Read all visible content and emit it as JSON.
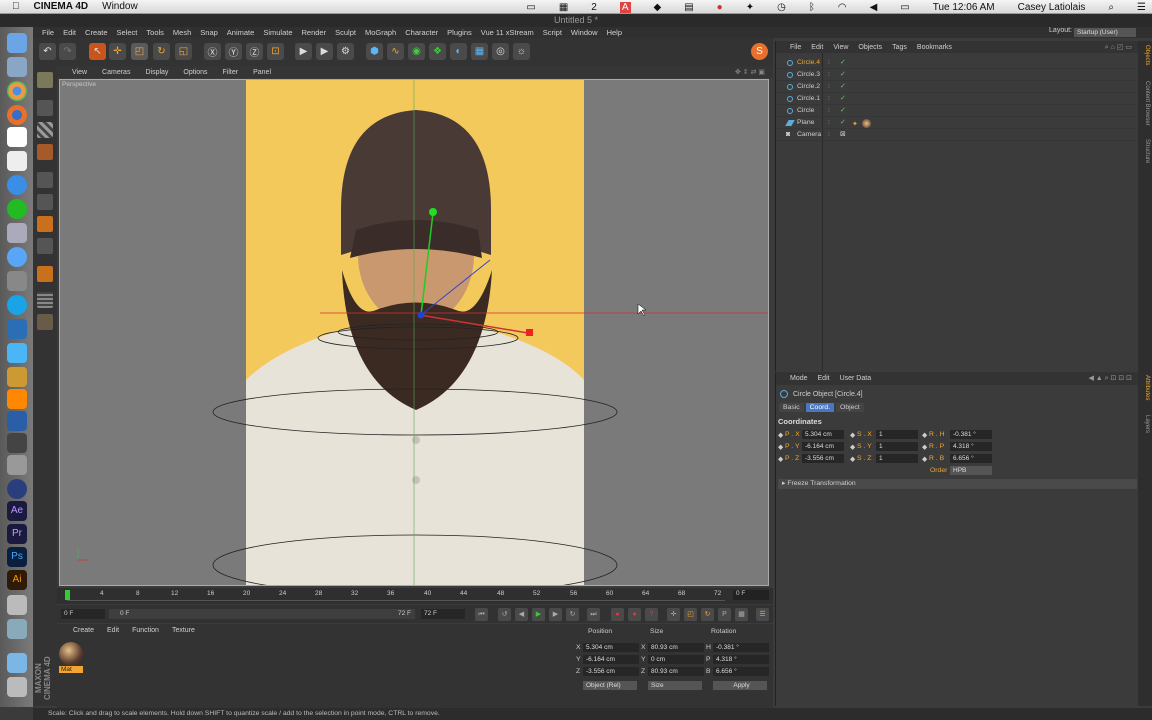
{
  "mac_menubar": {
    "app_name": "CINEMA 4D",
    "window_menu": "Window",
    "badge_count": "2",
    "time": "Tue 12:06 AM",
    "user": "Casey Latiolais"
  },
  "window_title": "Untitled 5 *",
  "menu": [
    "File",
    "Edit",
    "Create",
    "Select",
    "Tools",
    "Mesh",
    "Snap",
    "Animate",
    "Simulate",
    "Render",
    "Sculpt",
    "MoGraph",
    "Character",
    "Plugins",
    "Vue 11 xStream",
    "Script",
    "Window",
    "Help"
  ],
  "layout": {
    "label": "Layout:",
    "value": "Startup (User)"
  },
  "viewport_menu": [
    "View",
    "Cameras",
    "Display",
    "Options",
    "Filter",
    "Panel"
  ],
  "viewport_label": "Perspective",
  "timeline": {
    "ticks": [
      "0",
      "4",
      "8",
      "12",
      "16",
      "20",
      "24",
      "28",
      "32",
      "36",
      "40",
      "44",
      "48",
      "52",
      "56",
      "60",
      "64",
      "68",
      "72"
    ],
    "current_frame": "0 F"
  },
  "transport": {
    "start": "0 F",
    "preview_start": "0 F",
    "preview_end": "72 F",
    "end": "72 F"
  },
  "material_manager": {
    "menu": [
      "Create",
      "Edit",
      "Function",
      "Texture"
    ],
    "material_name": "Mat"
  },
  "maxon_logo": "MAXON CINEMA 4D",
  "coordinates": {
    "headers": [
      "Position",
      "Size",
      "Rotation"
    ],
    "rows": [
      {
        "axis": "X",
        "pos": "5.304 cm",
        "size_axis": "X",
        "size": "80.93 cm",
        "rot_axis": "H",
        "rot": "-0.381 °"
      },
      {
        "axis": "Y",
        "pos": "-6.164 cm",
        "size_axis": "Y",
        "size": "0 cm",
        "rot_axis": "P",
        "rot": "4.318 °"
      },
      {
        "axis": "Z",
        "pos": "-3.556 cm",
        "size_axis": "Z",
        "size": "80.93 cm",
        "rot_axis": "B",
        "rot": "6.656 °"
      }
    ],
    "mode_select": "Object (Rel)",
    "size_select": "Size",
    "apply_label": "Apply"
  },
  "object_manager": {
    "menu": [
      "File",
      "Edit",
      "View",
      "Objects",
      "Tags",
      "Bookmarks"
    ],
    "objects": [
      {
        "name": "Circle.4",
        "selected": true
      },
      {
        "name": "Circle.3",
        "selected": false
      },
      {
        "name": "Circle.2",
        "selected": false
      },
      {
        "name": "Circle.1",
        "selected": false
      },
      {
        "name": "Circle",
        "selected": false
      },
      {
        "name": "Plane",
        "selected": false
      },
      {
        "name": "Camera",
        "selected": false
      }
    ]
  },
  "attribute_manager": {
    "menu": [
      "Mode",
      "Edit",
      "User Data"
    ],
    "object_title": "Circle Object [Circle.4]",
    "tabs": [
      "Basic",
      "Coord.",
      "Object"
    ],
    "active_tab": "Coord.",
    "section": "Coordinates",
    "rows": [
      {
        "p_label": "P . X",
        "p_val": "5.304 cm",
        "s_label": "S . X",
        "s_val": "1",
        "r_label": "R . H",
        "r_val": "-0.381 °"
      },
      {
        "p_label": "P . Y",
        "p_val": "-6.164 cm",
        "s_label": "S . Y",
        "s_val": "1",
        "r_label": "R . P",
        "r_val": "4.318 °"
      },
      {
        "p_label": "P . Z",
        "p_val": "-3.556 cm",
        "s_label": "S . Z",
        "s_val": "1",
        "r_label": "R . B",
        "r_val": "6.656 °"
      }
    ],
    "order_label": "Order",
    "order_value": "HPB",
    "freeze_label": "Freeze Transformation"
  },
  "side_tabs": [
    "Objects",
    "Content Browser",
    "Structure",
    "Attributes",
    "Layers"
  ],
  "status_text": "Scale: Click and drag to scale elements. Hold down SHIFT to quantize scale / add to the selection in point mode, CTRL to remove.",
  "colors": {
    "accent": "#f2a531",
    "backdrop": "#f3c95c",
    "active_tab": "#4a78c0"
  }
}
